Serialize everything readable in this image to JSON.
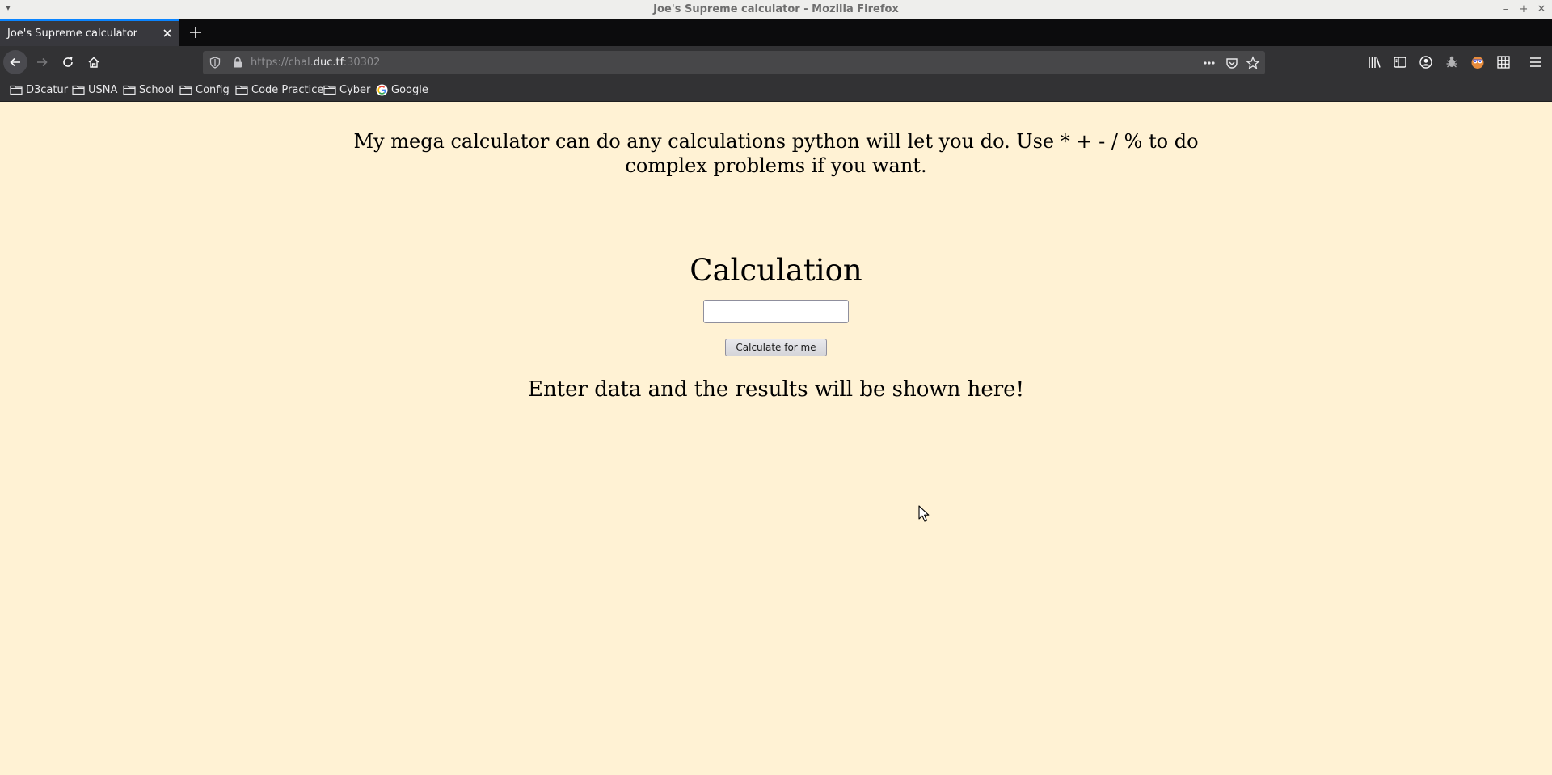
{
  "window": {
    "title": "Joe's Supreme calculator - Mozilla Firefox"
  },
  "tabs": [
    {
      "title": "Joe's Supreme calculator"
    }
  ],
  "navbar": {
    "url_prefix": "https://chal.",
    "url_host": "duc.tf",
    "url_suffix": ":30302"
  },
  "bookmarks": [
    {
      "label": "D3catur",
      "icon": "folder-icon"
    },
    {
      "label": "USNA",
      "icon": "folder-icon"
    },
    {
      "label": "School",
      "icon": "folder-icon"
    },
    {
      "label": "Config",
      "icon": "folder-icon"
    },
    {
      "label": "Code Practice",
      "icon": "folder-icon"
    },
    {
      "label": "Cyber",
      "icon": "folder-icon"
    },
    {
      "label": "Google",
      "icon": "google-icon"
    }
  ],
  "page": {
    "intro": "My mega calculator can do any calculations python will let you do. Use * + - / % to do complex problems if you want.",
    "heading": "Calculation",
    "input_value": "",
    "button_label": "Calculate for me",
    "result": "Enter data and the results will be shown here!"
  },
  "colors": {
    "page_background": "#fff2d4",
    "tab_accent": "#0a84ff"
  }
}
